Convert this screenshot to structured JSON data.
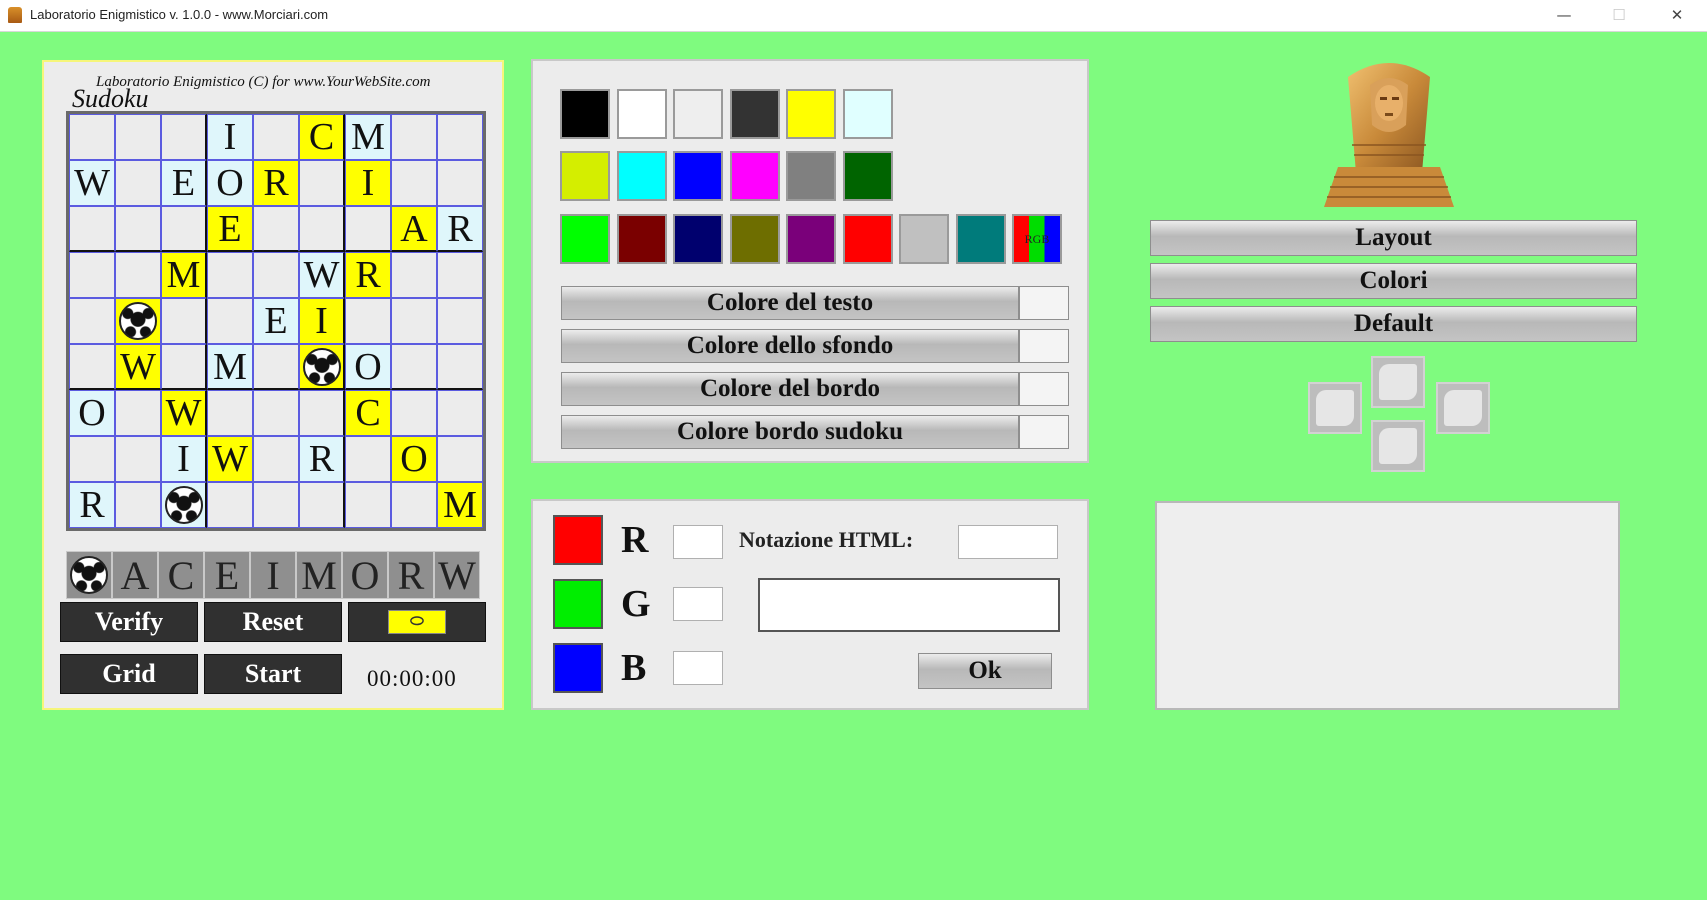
{
  "window": {
    "title": "Laboratorio Enigmistico v. 1.0.0 - www.Morciari.com",
    "minimize_glyph": "—",
    "maximize_glyph": "☐",
    "close_glyph": "✕"
  },
  "sudoku": {
    "credit": "Laboratorio Enigmistico (C) for www.YourWebSite.com",
    "title": "Sudoku",
    "grid": [
      [
        {
          "v": "",
          "c": "plain"
        },
        {
          "v": "",
          "c": "plain"
        },
        {
          "v": "",
          "c": "plain"
        },
        {
          "v": "I",
          "c": "light"
        },
        {
          "v": "",
          "c": "plain"
        },
        {
          "v": "C",
          "c": "yellow"
        },
        {
          "v": "M",
          "c": "light"
        },
        {
          "v": "",
          "c": "plain"
        },
        {
          "v": "",
          "c": "plain"
        }
      ],
      [
        {
          "v": "W",
          "c": "light"
        },
        {
          "v": "",
          "c": "plain"
        },
        {
          "v": "E",
          "c": "light"
        },
        {
          "v": "O",
          "c": "light"
        },
        {
          "v": "R",
          "c": "yellow"
        },
        {
          "v": "",
          "c": "plain"
        },
        {
          "v": "I",
          "c": "yellow"
        },
        {
          "v": "",
          "c": "plain"
        },
        {
          "v": "",
          "c": "plain"
        }
      ],
      [
        {
          "v": "",
          "c": "plain"
        },
        {
          "v": "",
          "c": "plain"
        },
        {
          "v": "",
          "c": "plain"
        },
        {
          "v": "E",
          "c": "yellow"
        },
        {
          "v": "",
          "c": "plain"
        },
        {
          "v": "",
          "c": "plain"
        },
        {
          "v": "",
          "c": "plain"
        },
        {
          "v": "A",
          "c": "yellow"
        },
        {
          "v": "R",
          "c": "light"
        }
      ],
      [
        {
          "v": "",
          "c": "plain"
        },
        {
          "v": "",
          "c": "plain"
        },
        {
          "v": "M",
          "c": "yellow"
        },
        {
          "v": "",
          "c": "plain"
        },
        {
          "v": "",
          "c": "plain"
        },
        {
          "v": "W",
          "c": "light"
        },
        {
          "v": "R",
          "c": "yellow"
        },
        {
          "v": "",
          "c": "plain"
        },
        {
          "v": "",
          "c": "plain"
        }
      ],
      [
        {
          "v": "",
          "c": "plain"
        },
        {
          "v": "ball",
          "c": "yellow"
        },
        {
          "v": "",
          "c": "plain"
        },
        {
          "v": "",
          "c": "plain"
        },
        {
          "v": "E",
          "c": "light"
        },
        {
          "v": "I",
          "c": "yellow"
        },
        {
          "v": "",
          "c": "plain"
        },
        {
          "v": "",
          "c": "plain"
        },
        {
          "v": "",
          "c": "plain"
        }
      ],
      [
        {
          "v": "",
          "c": "plain"
        },
        {
          "v": "W",
          "c": "yellow"
        },
        {
          "v": "",
          "c": "plain"
        },
        {
          "v": "M",
          "c": "light"
        },
        {
          "v": "",
          "c": "plain"
        },
        {
          "v": "ball",
          "c": "yellow"
        },
        {
          "v": "O",
          "c": "light"
        },
        {
          "v": "",
          "c": "plain"
        },
        {
          "v": "",
          "c": "plain"
        }
      ],
      [
        {
          "v": "O",
          "c": "light"
        },
        {
          "v": "",
          "c": "plain"
        },
        {
          "v": "W",
          "c": "yellow"
        },
        {
          "v": "",
          "c": "plain"
        },
        {
          "v": "",
          "c": "plain"
        },
        {
          "v": "",
          "c": "plain"
        },
        {
          "v": "C",
          "c": "yellow"
        },
        {
          "v": "",
          "c": "plain"
        },
        {
          "v": "",
          "c": "plain"
        }
      ],
      [
        {
          "v": "",
          "c": "plain"
        },
        {
          "v": "",
          "c": "plain"
        },
        {
          "v": "I",
          "c": "light"
        },
        {
          "v": "W",
          "c": "yellow"
        },
        {
          "v": "",
          "c": "plain"
        },
        {
          "v": "R",
          "c": "light"
        },
        {
          "v": "",
          "c": "plain"
        },
        {
          "v": "O",
          "c": "yellow"
        },
        {
          "v": "",
          "c": "plain"
        }
      ],
      [
        {
          "v": "R",
          "c": "light"
        },
        {
          "v": "",
          "c": "plain"
        },
        {
          "v": "ball",
          "c": "light"
        },
        {
          "v": "",
          "c": "plain"
        },
        {
          "v": "",
          "c": "plain"
        },
        {
          "v": "",
          "c": "plain"
        },
        {
          "v": "",
          "c": "plain"
        },
        {
          "v": "",
          "c": "plain"
        },
        {
          "v": "M",
          "c": "yellow"
        }
      ]
    ],
    "symbols": [
      "ball",
      "A",
      "C",
      "E",
      "I",
      "M",
      "O",
      "R",
      "W"
    ],
    "buttons": {
      "verify": "Verify",
      "reset": "Reset",
      "grid": "Grid",
      "start": "Start"
    },
    "timer": "00:00:00"
  },
  "palette": {
    "rows": [
      [
        "#000000",
        "#ffffff",
        "#eeeeee",
        "#333333",
        "#ffff00",
        "#e0ffff"
      ],
      [
        "#d4ee00",
        "#00ffff",
        "#0000ff",
        "#ff00ff",
        "#808080",
        "#006400"
      ],
      [
        "#00ff00",
        "#7a0000",
        "#00006e",
        "#6e6e00",
        "#7a007a",
        "#ff0000",
        "#c0c0c0",
        "#007b7b",
        "multi"
      ]
    ],
    "multi_label": "RGB",
    "buttons": [
      {
        "label": "Colore del testo"
      },
      {
        "label": "Colore dello sfondo"
      },
      {
        "label": "Colore del bordo"
      },
      {
        "label": "Colore bordo sudoku"
      }
    ]
  },
  "rgb": {
    "r_label": "R",
    "g_label": "G",
    "b_label": "B",
    "r_color": "#ff0000",
    "g_color": "#00ee00",
    "b_color": "#0000ff",
    "r_value": "",
    "g_value": "",
    "b_value": "",
    "html_label": "Notazione HTML:",
    "html_value": "",
    "ok_label": "Ok"
  },
  "right": {
    "buttons": {
      "layout": "Layout",
      "colori": "Colori",
      "default": "Default"
    }
  }
}
